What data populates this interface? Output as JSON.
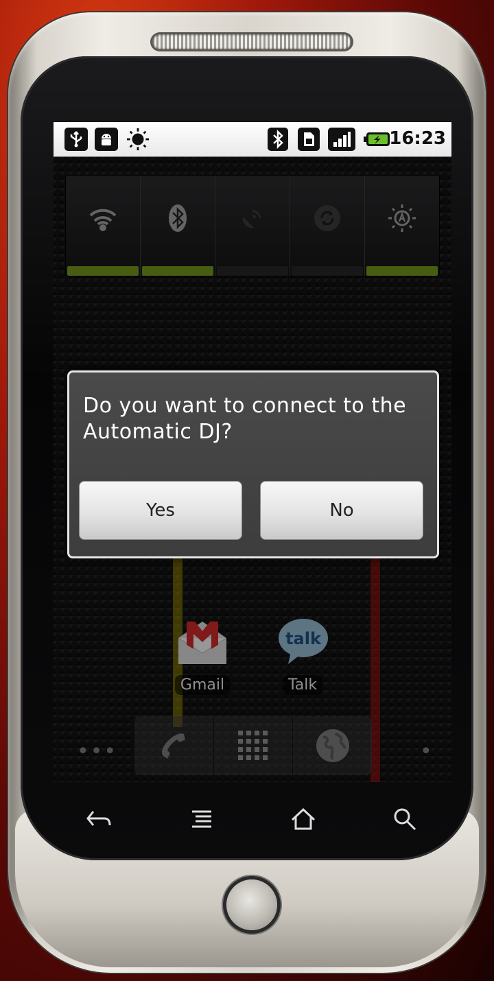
{
  "status_bar": {
    "time": "16:23",
    "left_icons": [
      "usb-icon",
      "android-debug-icon",
      "brightness-icon"
    ],
    "right_icons": [
      "bluetooth-icon",
      "sim-icon",
      "signal-icon",
      "battery-charging-icon"
    ]
  },
  "power_widget": {
    "toggles": [
      {
        "name": "wifi",
        "icon": "wifi-icon",
        "on": true
      },
      {
        "name": "bluetooth",
        "icon": "bluetooth-icon",
        "on": true
      },
      {
        "name": "gps",
        "icon": "gps-icon",
        "on": false
      },
      {
        "name": "sync",
        "icon": "sync-icon",
        "on": false
      },
      {
        "name": "brightness",
        "icon": "auto-brightness-icon",
        "on": true
      }
    ],
    "on_color": "#6c8f1c",
    "off_color": "#2a2a2a"
  },
  "dialog": {
    "message": "Do you want to connect to the Automatic DJ?",
    "yes_label": "Yes",
    "no_label": "No"
  },
  "home": {
    "apps": [
      {
        "label": "Gmail",
        "icon": "gmail-icon"
      },
      {
        "label": "Talk",
        "icon": "talk-icon",
        "icon_text": "talk"
      }
    ],
    "dock": [
      "phone-icon",
      "app-drawer-icon",
      "browser-icon"
    ]
  },
  "nav_keys": [
    "back-icon",
    "menu-icon",
    "home-icon",
    "search-icon"
  ]
}
